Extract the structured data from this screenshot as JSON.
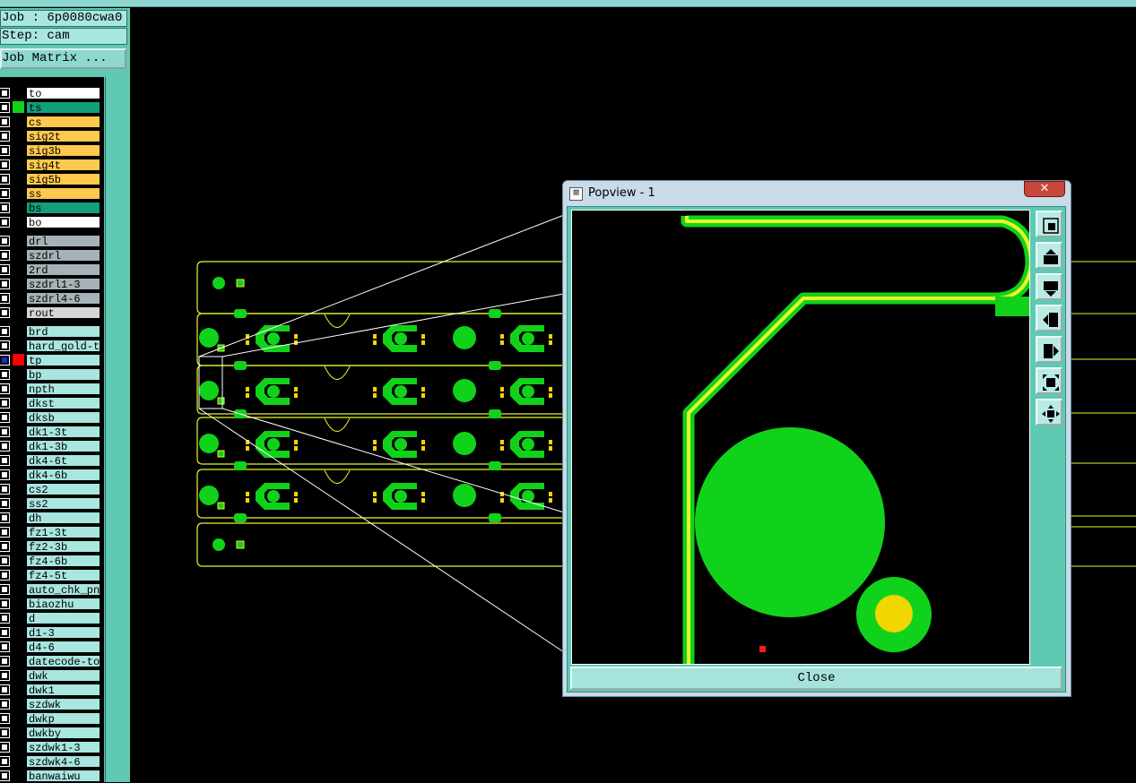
{
  "job_label": "Job : 6p0080cwa0",
  "step_label": "Step: cam",
  "job_matrix_label": "Job Matrix ...",
  "layers": [
    {
      "name": "to",
      "color": "#ffffff",
      "swatch": "#000000"
    },
    {
      "name": "ts",
      "color": "#11a07a",
      "swatch": "#11d21a"
    },
    {
      "name": "cs",
      "color": "#ffc94d",
      "swatch": "#000000"
    },
    {
      "name": "sig2t",
      "color": "#ffc94d",
      "swatch": "#000000"
    },
    {
      "name": "sig3b",
      "color": "#ffc94d",
      "swatch": "#000000"
    },
    {
      "name": "sig4t",
      "color": "#ffc94d",
      "swatch": "#000000"
    },
    {
      "name": "sig5b",
      "color": "#ffc94d",
      "swatch": "#000000"
    },
    {
      "name": "ss",
      "color": "#ffc94d",
      "swatch": "#000000"
    },
    {
      "name": "bs",
      "color": "#11a07a",
      "swatch": "#000000"
    },
    {
      "name": "bo",
      "color": "#ffffff",
      "swatch": "#000000"
    },
    {
      "name": "drl",
      "color": "#a7b2b8",
      "swatch": "#000000"
    },
    {
      "name": "szdrl",
      "color": "#a7b2b8",
      "swatch": "#000000"
    },
    {
      "name": "2rd",
      "color": "#a7b2b8",
      "swatch": "#000000"
    },
    {
      "name": "szdrl1-3",
      "color": "#a7b2b8",
      "swatch": "#000000"
    },
    {
      "name": "szdrl4-6",
      "color": "#a7b2b8",
      "swatch": "#000000"
    },
    {
      "name": "rout",
      "color": "#d6d6d6",
      "swatch": "#000000"
    },
    {
      "name": "brd",
      "color": "#a8e6df",
      "swatch": "#000000"
    },
    {
      "name": "hard_gold-to",
      "color": "#a8e6df",
      "swatch": "#000000"
    },
    {
      "name": "tp",
      "color": "#a8e6df",
      "swatch": "#ff0000",
      "chk_color": "#1d2bd0"
    },
    {
      "name": "bp",
      "color": "#a8e6df",
      "swatch": "#000000"
    },
    {
      "name": "npth",
      "color": "#a8e6df",
      "swatch": "#000000"
    },
    {
      "name": "dkst",
      "color": "#a8e6df",
      "swatch": "#000000"
    },
    {
      "name": "dksb",
      "color": "#a8e6df",
      "swatch": "#000000"
    },
    {
      "name": "dk1-3t",
      "color": "#a8e6df",
      "swatch": "#000000"
    },
    {
      "name": "dk1-3b",
      "color": "#a8e6df",
      "swatch": "#000000"
    },
    {
      "name": "dk4-6t",
      "color": "#a8e6df",
      "swatch": "#000000"
    },
    {
      "name": "dk4-6b",
      "color": "#a8e6df",
      "swatch": "#000000"
    },
    {
      "name": "cs2",
      "color": "#a8e6df",
      "swatch": "#000000"
    },
    {
      "name": "ss2",
      "color": "#a8e6df",
      "swatch": "#000000"
    },
    {
      "name": "dh",
      "color": "#a8e6df",
      "swatch": "#000000"
    },
    {
      "name": "fz1-3t",
      "color": "#a8e6df",
      "swatch": "#000000"
    },
    {
      "name": "fz2-3b",
      "color": "#a8e6df",
      "swatch": "#000000"
    },
    {
      "name": "fz4-6b",
      "color": "#a8e6df",
      "swatch": "#000000"
    },
    {
      "name": "fz4-5t",
      "color": "#a8e6df",
      "swatch": "#000000"
    },
    {
      "name": "auto_chk_pnl",
      "color": "#a8e6df",
      "swatch": "#000000"
    },
    {
      "name": "biaozhu",
      "color": "#a8e6df",
      "swatch": "#000000"
    },
    {
      "name": "d",
      "color": "#a8e6df",
      "swatch": "#000000"
    },
    {
      "name": "d1-3",
      "color": "#a8e6df",
      "swatch": "#000000"
    },
    {
      "name": "d4-6",
      "color": "#a8e6df",
      "swatch": "#000000"
    },
    {
      "name": "datecode-to",
      "color": "#a8e6df",
      "swatch": "#000000"
    },
    {
      "name": "dwk",
      "color": "#a8e6df",
      "swatch": "#000000"
    },
    {
      "name": "dwk1",
      "color": "#a8e6df",
      "swatch": "#000000"
    },
    {
      "name": "szdwk",
      "color": "#a8e6df",
      "swatch": "#000000"
    },
    {
      "name": "dwkp",
      "color": "#a8e6df",
      "swatch": "#000000"
    },
    {
      "name": "dwkby",
      "color": "#a8e6df",
      "swatch": "#000000"
    },
    {
      "name": "szdwk1-3",
      "color": "#a8e6df",
      "swatch": "#000000"
    },
    {
      "name": "szdwk4-6",
      "color": "#a8e6df",
      "swatch": "#000000"
    },
    {
      "name": "banwaiwu",
      "color": "#a8e6df",
      "swatch": "#000000"
    }
  ],
  "popview": {
    "title": "Popview - 1",
    "close_x": "✕",
    "close_button": "Close",
    "tools": [
      "zoom-fit-icon",
      "pan-up-icon",
      "pan-down-icon",
      "pan-left-icon",
      "pan-right-icon",
      "zoom-in-icon",
      "zoom-out-icon"
    ]
  },
  "colors": {
    "board_green": "#11d21a",
    "outline_yellow": "#e8f52a",
    "pad_yellow": "#f2d602",
    "marker_red": "#ff1a1a"
  }
}
